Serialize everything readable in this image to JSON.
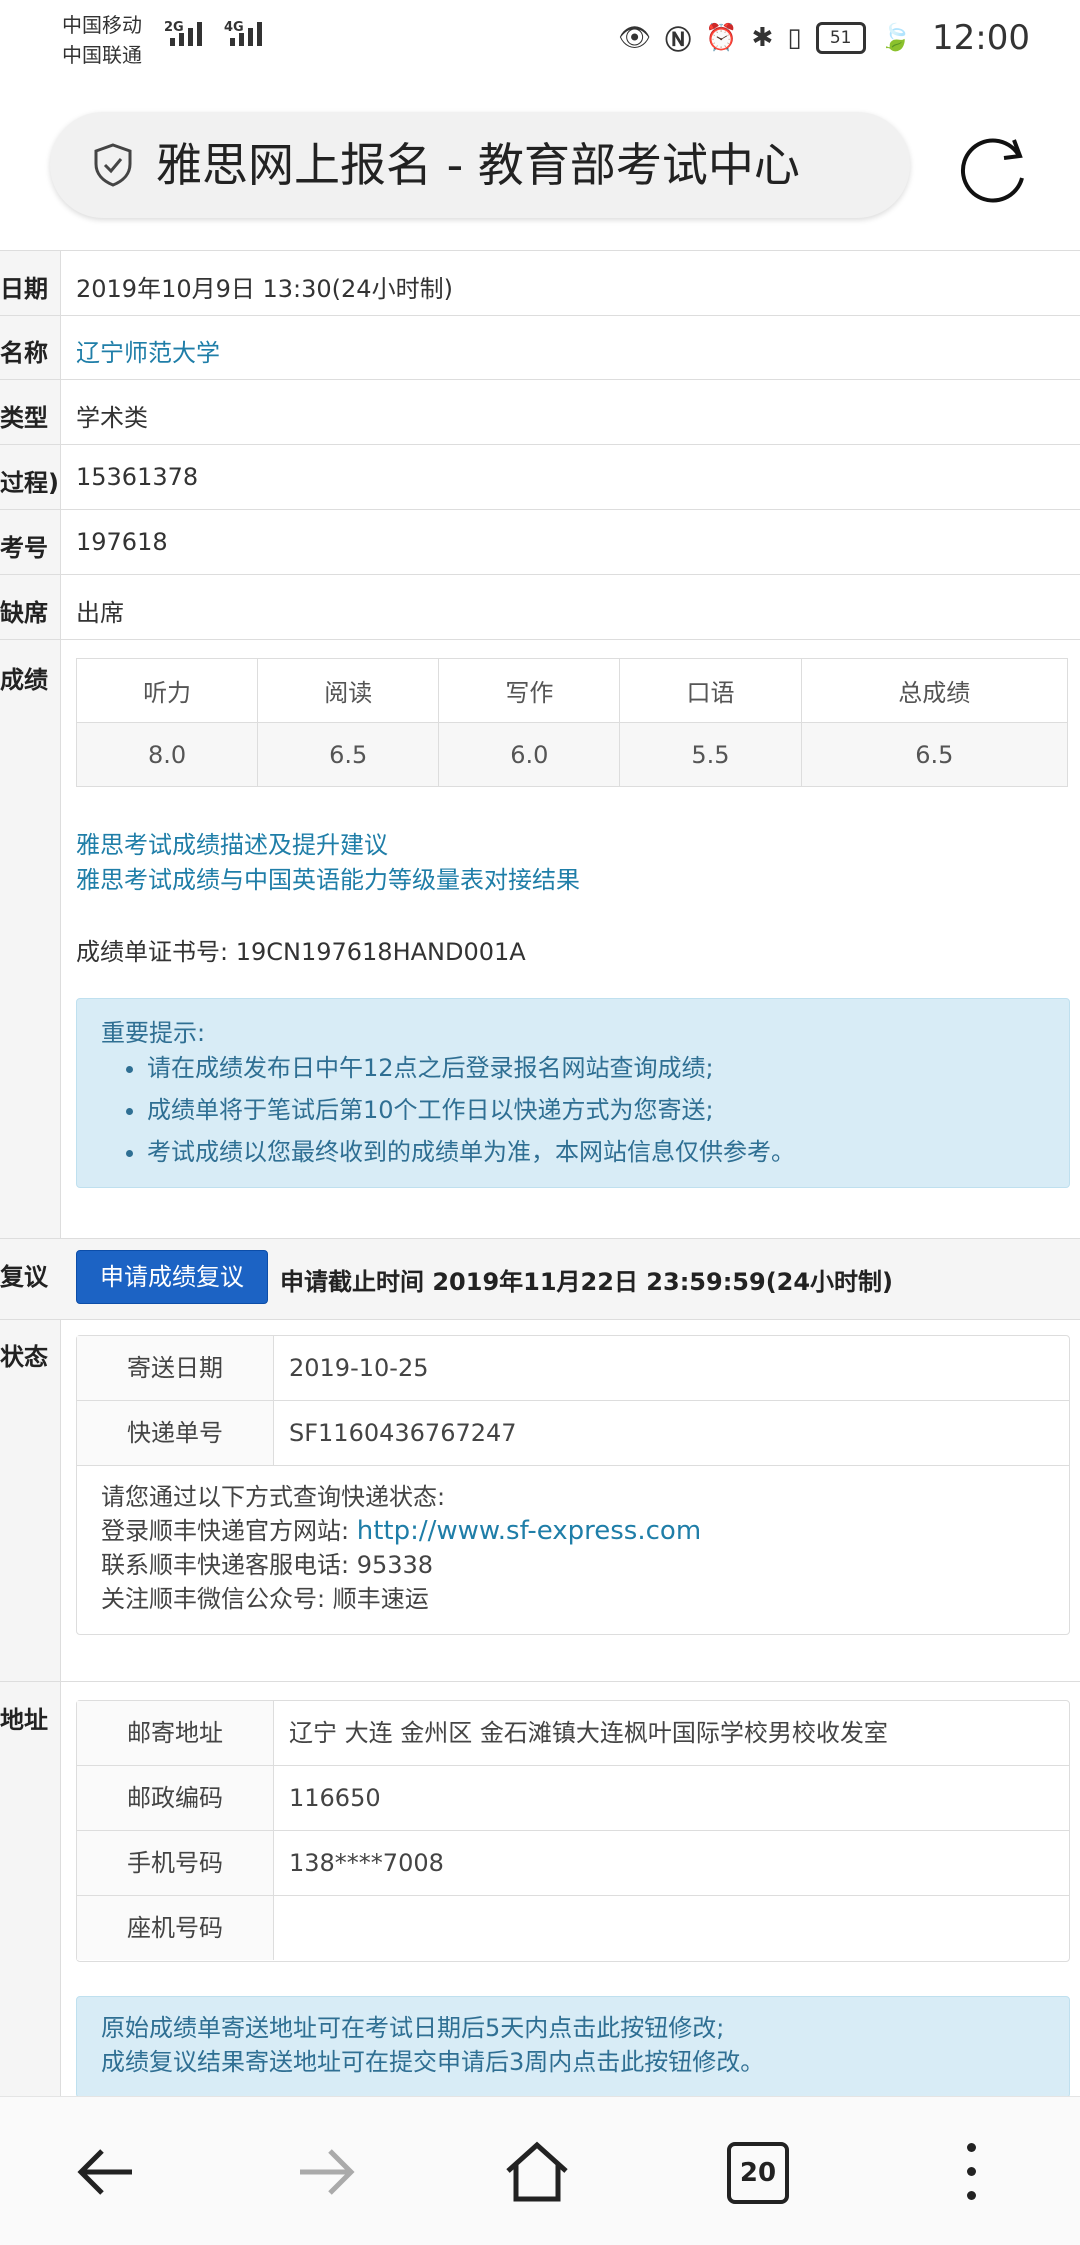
{
  "status_bar": {
    "carrier1": "中国移动",
    "carrier2": "中国联通",
    "net1": "2G",
    "net2": "4G",
    "battery": "51",
    "time": "12:00"
  },
  "address_bar": {
    "title": "雅思网上报名 - 教育部考试中心"
  },
  "rows": {
    "date_label": "日期",
    "date_value": "2019年10月9日 13:30(24小时制)",
    "name_label": "名称",
    "name_value": "辽宁师范大学",
    "type_label": "类型",
    "type_value": "学术类",
    "id_label": "过程)",
    "id_value": "15361378",
    "exam_no_label": "考号",
    "exam_no_value": "197618",
    "attendance_label": "缺席",
    "attendance_value": "出席",
    "score_label": "成绩"
  },
  "scores": {
    "headers": [
      "听力",
      "阅读",
      "写作",
      "口语",
      "总成绩"
    ],
    "values": [
      "8.0",
      "6.5",
      "6.0",
      "5.5",
      "6.5"
    ]
  },
  "links": {
    "desc": "雅思考试成绩描述及提升建议",
    "cefr": "雅思考试成绩与中国英语能力等级量表对接结果"
  },
  "certificate": "成绩单证书号: 19CN197618HAND001A",
  "notice": {
    "title": "重要提示:",
    "items": [
      "请在成绩发布日中午12点之后登录报名网站查询成绩;",
      "成绩单将于笔试后第10个工作日以快递方式为您寄送;",
      "考试成绩以您最终收到的成绩单为准，本网站信息仅供参考。"
    ]
  },
  "review": {
    "label": "复议",
    "button": "申请成绩复议",
    "deadline": "申请截止时间 2019年11月22日 23:59:59(24小时制)"
  },
  "delivery": {
    "label": "状态",
    "send_date_key": "寄送日期",
    "send_date_val": "2019-10-25",
    "tracking_key": "快递单号",
    "tracking_val": "SF1160436767247",
    "help1": "请您通过以下方式查询快递状态:",
    "help2_prefix": "登录顺丰快递官方网站:",
    "help2_link": "http://www.sf-express.com",
    "help3": "联系顺丰快递客服电话:  95338",
    "help4": "关注顺丰微信公众号:  顺丰速运"
  },
  "address": {
    "label": "地址",
    "mail_key": "邮寄地址",
    "mail_val": "辽宁 大连 金州区 金石滩镇大连枫叶国际学校男校收发室",
    "zip_key": "邮政编码",
    "zip_val": "116650",
    "mobile_key": "手机号码",
    "mobile_val": "138****7008",
    "phone_key": "座机号码",
    "phone_val": "",
    "note1": "原始成绩单寄送地址可在考试日期后5天内点击此按钮修改;",
    "note2": "成绩复议结果寄送地址可在提交申请后3周内点击此按钮修改。"
  },
  "nav": {
    "tab_count": "20"
  }
}
